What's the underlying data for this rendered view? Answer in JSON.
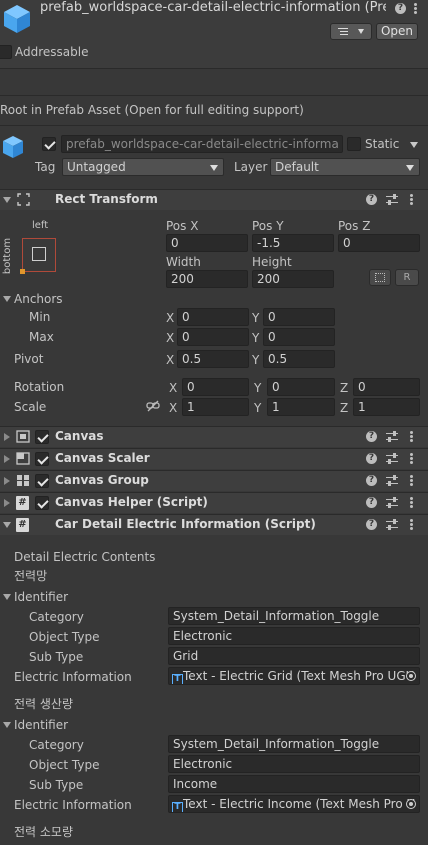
{
  "asset": {
    "title": "prefab_worldspace-car-detail-electric-information (Pref",
    "open_label": "Open",
    "addressable_label": "Addressable",
    "addressable_checked": false
  },
  "prefab_notice": "Root in Prefab Asset (Open for full editing support)",
  "gameobject": {
    "active": true,
    "name": "prefab_worldspace-car-detail-electric-informa",
    "static_label": "Static",
    "static_checked": false,
    "tag_label": "Tag",
    "tag_value": "Untagged",
    "layer_label": "Layer",
    "layer_value": "Default"
  },
  "rect_transform": {
    "title": "Rect Transform",
    "anchor_preset_top": "left",
    "anchor_preset_side": "bottom",
    "pos_x_label": "Pos X",
    "pos_y_label": "Pos Y",
    "pos_z_label": "Pos Z",
    "pos_x": "0",
    "pos_y": "-1.5",
    "pos_z": "0",
    "width_label": "Width",
    "height_label": "Height",
    "width": "200",
    "height": "200",
    "r_button": "R",
    "anchors_label": "Anchors",
    "min_label": "Min",
    "max_label": "Max",
    "min_x": "0",
    "min_y": "0",
    "max_x": "0",
    "max_y": "0",
    "pivot_label": "Pivot",
    "pivot_x": "0.5",
    "pivot_y": "0.5",
    "rotation_label": "Rotation",
    "rot_x": "0",
    "rot_y": "0",
    "rot_z": "0",
    "scale_label": "Scale",
    "scale_x": "1",
    "scale_y": "1",
    "scale_z": "1",
    "x": "X",
    "y": "Y",
    "z": "Z"
  },
  "components": [
    {
      "title": "Canvas",
      "enabled": true
    },
    {
      "title": "Canvas Scaler",
      "enabled": true
    },
    {
      "title": "Canvas Group",
      "enabled": true
    },
    {
      "title": "Canvas Helper (Script)",
      "enabled": true
    }
  ],
  "script": {
    "title": "Car Detail Electric Information (Script)",
    "section_label": "Detail Electric Contents",
    "groups": [
      {
        "heading": "전력망",
        "identifier_label": "Identifier",
        "category_label": "Category",
        "category_value": "System_Detail_Information_Toggle",
        "object_type_label": "Object Type",
        "object_type_value": "Electronic",
        "sub_type_label": "Sub Type",
        "sub_type_value": "Grid",
        "info_label": "Electric Information",
        "info_value": "Text - Electric Grid (Text Mesh Pro UGU"
      },
      {
        "heading": "전력 생산량",
        "identifier_label": "Identifier",
        "category_label": "Category",
        "category_value": "System_Detail_Information_Toggle",
        "object_type_label": "Object Type",
        "object_type_value": "Electronic",
        "sub_type_label": "Sub Type",
        "sub_type_value": "Income",
        "info_label": "Electric Information",
        "info_value": "Text - Electric Income (Text Mesh Pro U"
      }
    ],
    "trailing_heading": "전력 소모량"
  }
}
